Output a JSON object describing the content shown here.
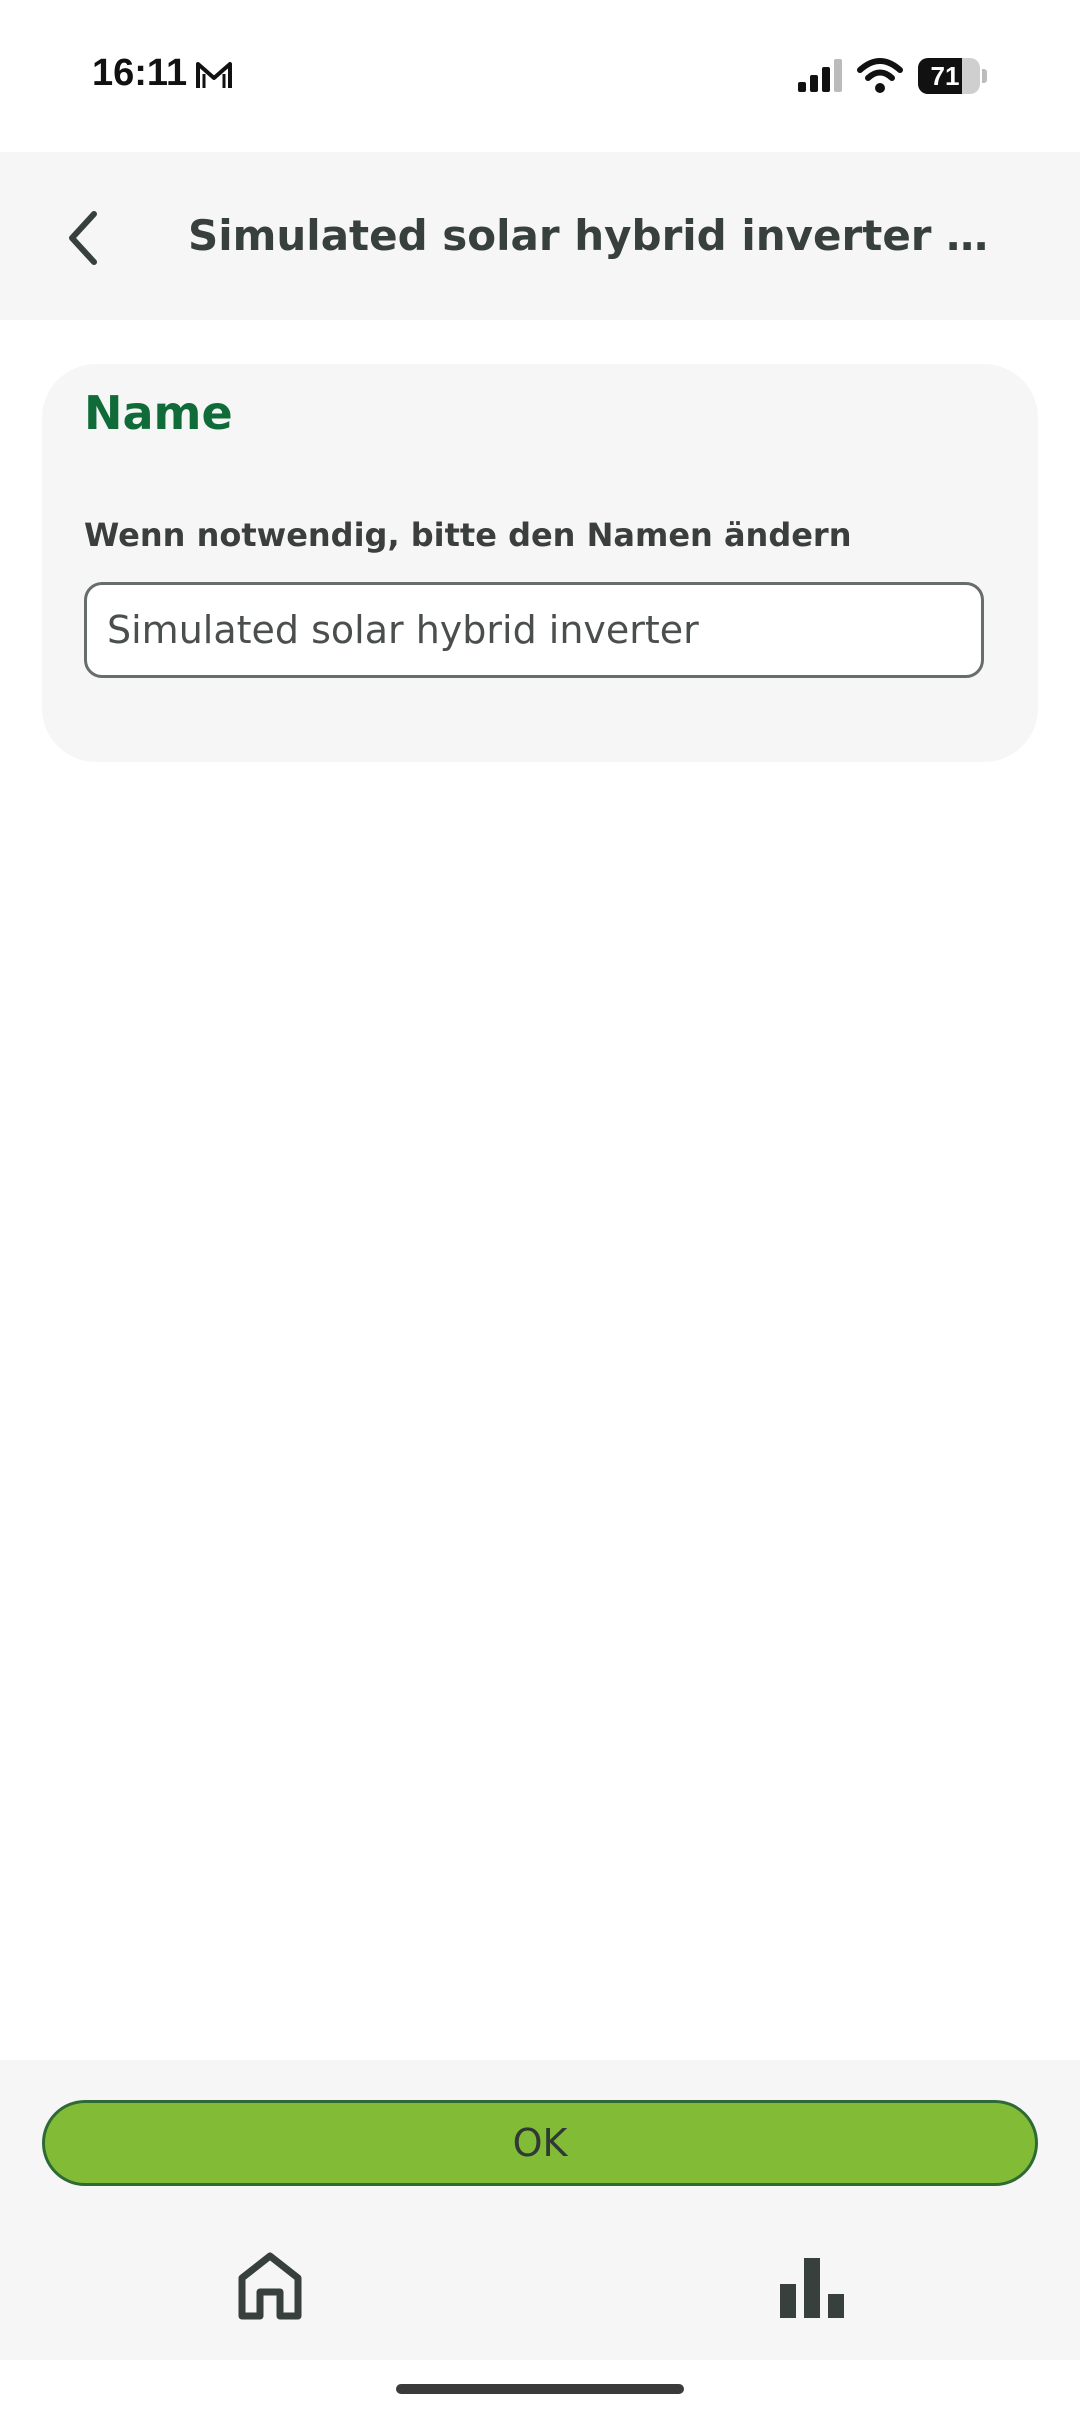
{
  "status_bar": {
    "time": "16:11",
    "battery_level": "71",
    "battery_fraction": 0.71,
    "icons": [
      "mail-icon",
      "signal-icon",
      "wifi-icon",
      "battery-icon"
    ]
  },
  "header": {
    "title": "Simulated solar hybrid inverter ei…",
    "back_icon": "chevron-left-icon"
  },
  "card": {
    "title": "Name",
    "field_label": "Wenn notwendig, bitte den Namen ändern",
    "name_value": "Simulated solar hybrid inverter"
  },
  "footer": {
    "ok_label": "OK",
    "nav_items": [
      {
        "icon": "home-icon"
      },
      {
        "icon": "bar-chart-icon"
      }
    ]
  },
  "colors": {
    "accent_green": "#0f6b38",
    "button_green": "#82bb36",
    "header_bg": "#f6f6f6",
    "text_dark": "#37403d"
  }
}
